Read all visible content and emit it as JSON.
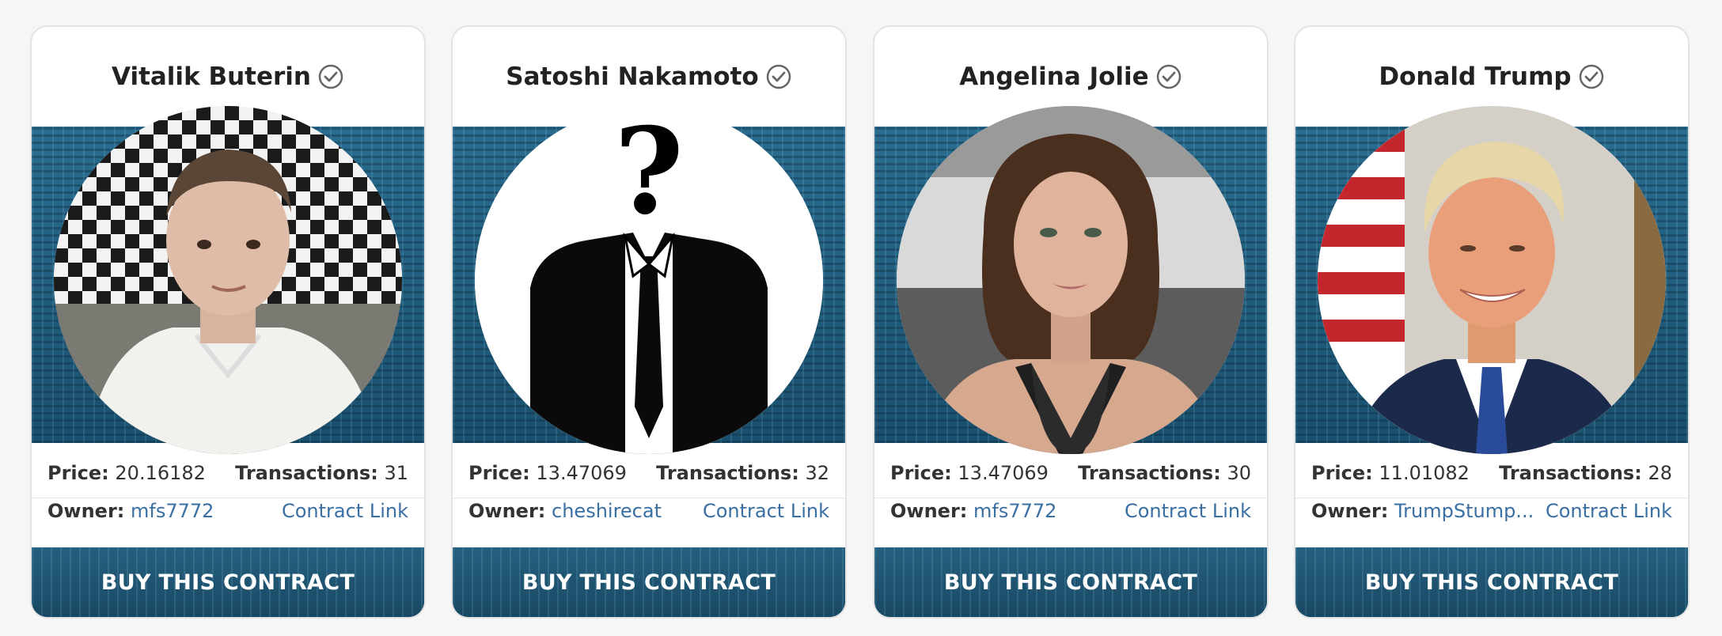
{
  "labels": {
    "price": "Price:",
    "transactions": "Transactions:",
    "owner": "Owner:",
    "contract_link": "Contract Link",
    "buy": "BUY THIS CONTRACT"
  },
  "icons": {
    "verified": "check-circle-icon"
  },
  "colors": {
    "accent": "#3a6fa3",
    "banner": "#1f5a7a"
  },
  "cards": [
    {
      "name": "Vitalik Buterin",
      "price": "20.16182",
      "transactions": "31",
      "owner": "mfs7772"
    },
    {
      "name": "Satoshi Nakamoto",
      "price": "13.47069",
      "transactions": "32",
      "owner": "cheshirecat"
    },
    {
      "name": "Angelina Jolie",
      "price": "13.47069",
      "transactions": "30",
      "owner": "mfs7772"
    },
    {
      "name": "Donald Trump",
      "price": "11.01082",
      "transactions": "28",
      "owner": "TrumpStump..."
    }
  ]
}
